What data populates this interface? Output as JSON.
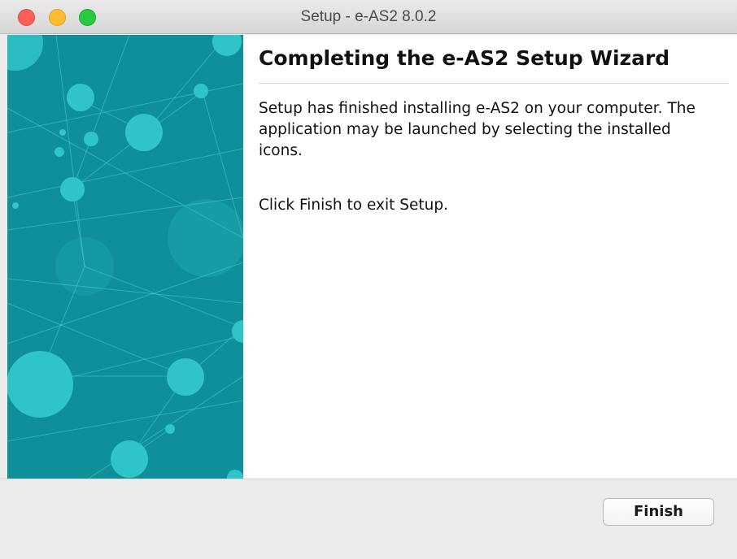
{
  "window": {
    "title": "Setup - e-AS2 8.0.2"
  },
  "wizard": {
    "heading": "Completing the e-AS2 Setup Wizard",
    "paragraph1": "Setup has finished installing e-AS2 on your computer. The application may be launched by selecting the installed icons.",
    "paragraph2": "Click Finish to exit Setup."
  },
  "buttons": {
    "finish_label": "Finish"
  },
  "colors": {
    "side_panel": "#0e8f9a",
    "node": "#2fc4c9",
    "close": "#fe5f57",
    "minimize": "#febc2e",
    "maximize": "#28c840"
  }
}
